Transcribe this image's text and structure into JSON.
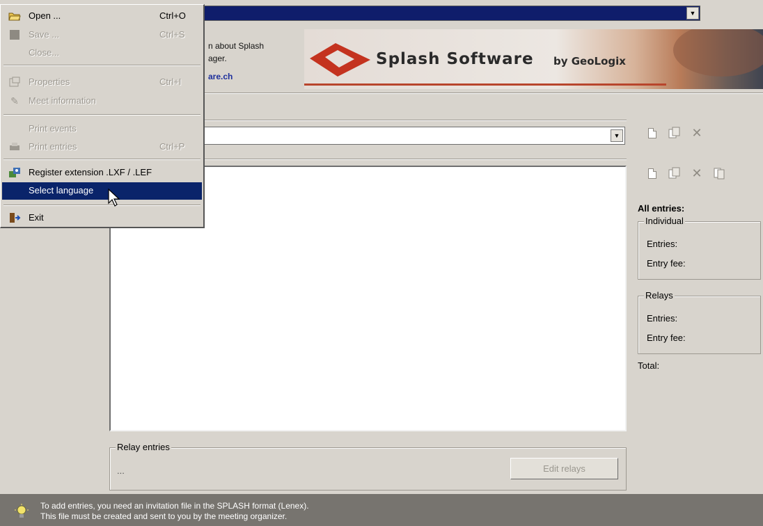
{
  "top_combo": {
    "value": ""
  },
  "info": {
    "line1": "n about Splash",
    "line2": "ager.",
    "link": "are.ch"
  },
  "banner": {
    "title": "Splash Software",
    "by": "by GeoLogix"
  },
  "relay_group": {
    "legend": "Relay entries",
    "value": "...",
    "edit_button": "Edit relays"
  },
  "summary": {
    "all_entries": "All entries:",
    "individual": {
      "legend": "Individual",
      "entries": "Entries:",
      "fee": "Entry fee:"
    },
    "relays": {
      "legend": "Relays",
      "entries": "Entries:",
      "fee": "Entry fee:"
    },
    "total": "Total:"
  },
  "status": {
    "line1": "To add entries, you need an invitation file in the SPLASH format (Lenex).",
    "line2": "This file must be created and sent to you by the meeting organizer."
  },
  "menu": {
    "open": {
      "label": "Open ...",
      "shortcut": "Ctrl+O"
    },
    "save": {
      "label": "Save ...",
      "shortcut": "Ctrl+S"
    },
    "close": {
      "label": "Close..."
    },
    "properties": {
      "label": "Properties",
      "shortcut": "Ctrl+I"
    },
    "meet_info": {
      "label": "Meet information"
    },
    "print_events": {
      "label": "Print events"
    },
    "print_entries": {
      "label": "Print entries",
      "shortcut": "Ctrl+P"
    },
    "register_ext": {
      "label": "Register extension .LXF / .LEF"
    },
    "select_language": {
      "label": "Select language"
    },
    "exit": {
      "label": "Exit"
    }
  },
  "colors": {
    "selection": "#0a246a",
    "status_bar": "#77746f",
    "window": "#d8d4cd",
    "link": "#1d2f9c"
  },
  "icons": [
    "open-folder-icon",
    "save-icon",
    "properties-icon",
    "meet-info-icon",
    "printer-icon",
    "register-extension-icon",
    "exit-icon",
    "new-document-icon",
    "copy-icon",
    "delete-icon",
    "paste-icon",
    "lightbulb-icon",
    "cursor-icon",
    "dropdown-arrow-icon"
  ]
}
